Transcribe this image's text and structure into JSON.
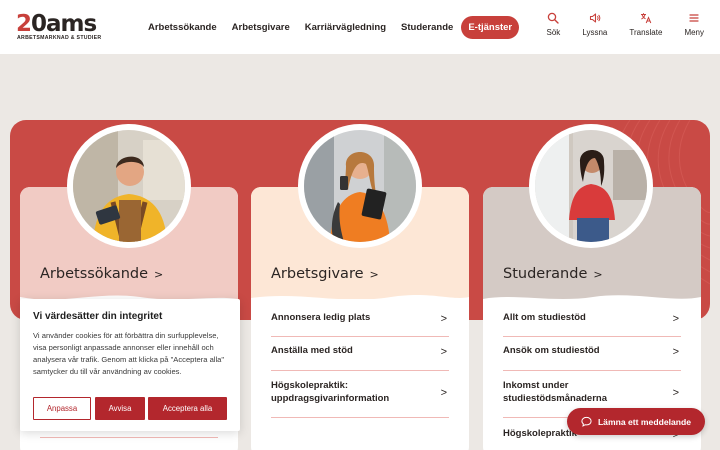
{
  "header": {
    "logo": {
      "mark": "20ams",
      "sub": "ARBETSMARKNAD & STUDIER"
    },
    "nav": [
      {
        "label": "Arbetssökande"
      },
      {
        "label": "Arbetsgivare"
      },
      {
        "label": "Karriärvägledning"
      },
      {
        "label": "Studerande"
      },
      {
        "label": "E-tjänster",
        "active": true
      }
    ],
    "tools": [
      {
        "label": "Sök",
        "icon": "search-icon"
      },
      {
        "label": "Lyssna",
        "icon": "speaker-icon"
      },
      {
        "label": "Translate",
        "icon": "translate-icon"
      },
      {
        "label": "Meny",
        "icon": "menu-icon"
      }
    ]
  },
  "colors": {
    "accent": "#c8403b",
    "button": "#b3272d",
    "band": "#c94a45",
    "card1": "#f1cbc4",
    "card2": "#fde7d6",
    "card3": "#d4cac5",
    "divider": "#f0b9b6"
  },
  "cards": [
    {
      "title": "Arbetssökande",
      "links": []
    },
    {
      "title": "Arbetsgivare",
      "links": [
        {
          "label": "Annonsera ledig plats"
        },
        {
          "label": "Anställa med stöd"
        },
        {
          "label": "Högskolepraktik: uppdragsgivarinformation"
        }
      ]
    },
    {
      "title": "Studerande",
      "links": [
        {
          "label": "Allt om studiestöd"
        },
        {
          "label": "Ansök om studiestöd"
        },
        {
          "label": "Inkomst under studiestödsmånaderna"
        },
        {
          "label": "Högskolepraktik"
        }
      ]
    }
  ],
  "cookie": {
    "title": "Vi värdesätter din integritet",
    "body": "Vi använder cookies för att förbättra din surfupplevelse, visa personligt anpassade annonser eller innehåll och analysera vår trafik. Genom att klicka på \"Acceptera alla\" samtycker du till vår användning av cookies.",
    "customize": "Anpassa",
    "reject": "Avvisa",
    "accept": "Acceptera alla"
  },
  "message_button": {
    "label": "Lämna ett meddelande",
    "icon": "chat-icon"
  }
}
